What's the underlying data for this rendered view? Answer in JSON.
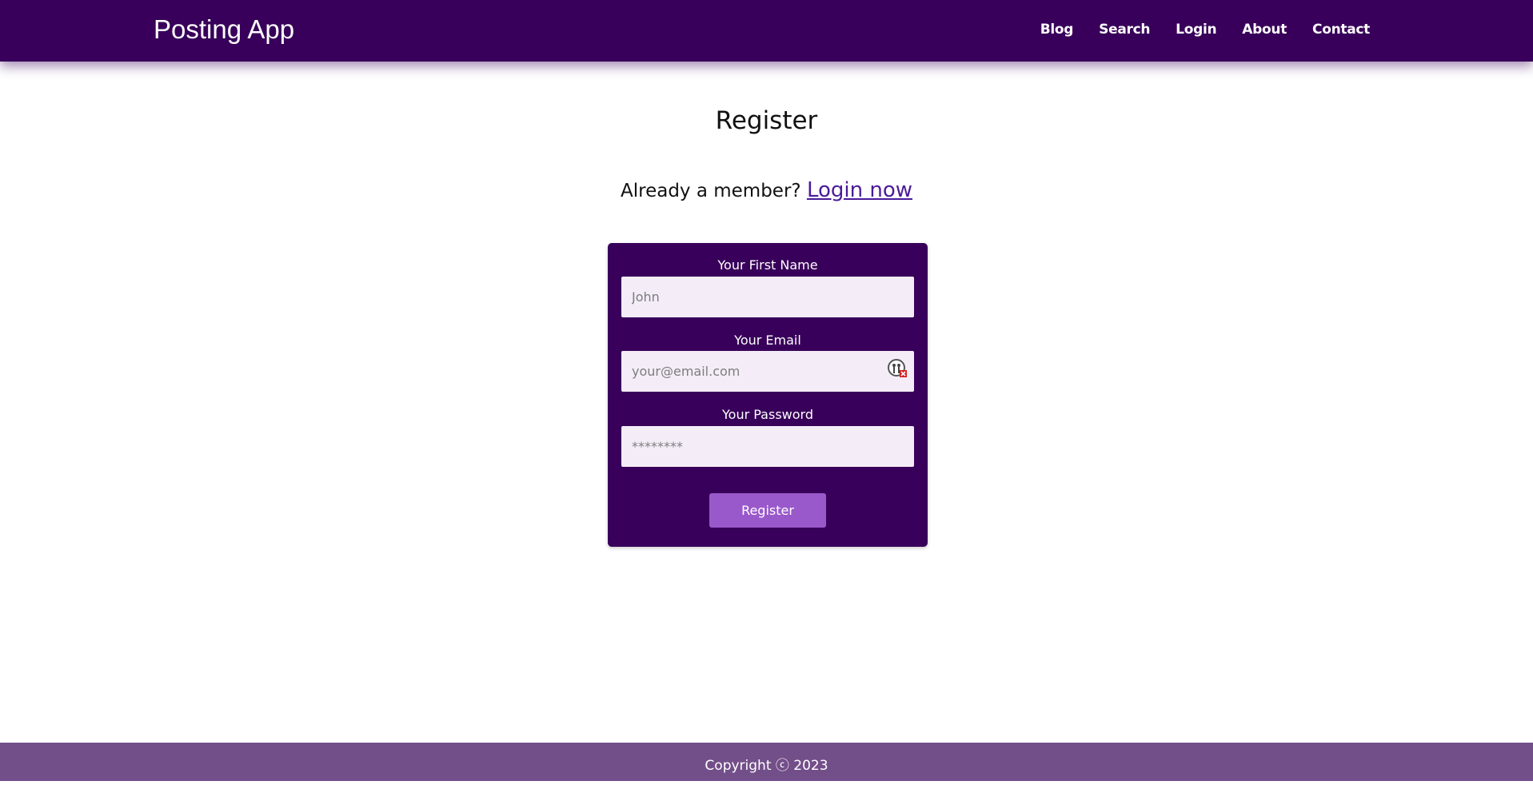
{
  "navbar": {
    "brand": "Posting App",
    "links": [
      "Blog",
      "Search",
      "Login",
      "About",
      "Contact"
    ]
  },
  "page": {
    "title": "Register",
    "member_prompt": "Already a member?",
    "login_link": "Login now"
  },
  "form": {
    "first_name": {
      "label": "Your First Name",
      "placeholder": "John",
      "value": ""
    },
    "email": {
      "label": "Your Email",
      "placeholder": "your@email.com",
      "value": "",
      "icon": "password-manager-icon"
    },
    "password": {
      "label": "Your Password",
      "placeholder": "********",
      "value": ""
    },
    "submit_label": "Register"
  },
  "footer": {
    "text": "Copyright ⓒ 2023"
  },
  "colors": {
    "primary": "#38005a",
    "button": "#9a59cb",
    "footer": "#734f8a",
    "input_bg": "#f4edf8",
    "link": "#4b1a9a"
  }
}
